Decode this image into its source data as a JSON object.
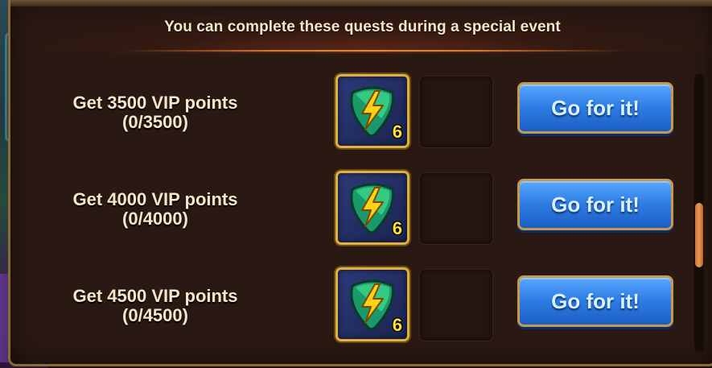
{
  "header": {
    "title": "You can complete these quests during a special event"
  },
  "quests": [
    {
      "title": "Get 3500 VIP points",
      "progress": "(0/3500)",
      "reward": {
        "icon": "energy-guitar-pick-icon",
        "quantity": "6"
      },
      "button_label": "Go for it!"
    },
    {
      "title": "Get 4000 VIP points",
      "progress": "(0/4000)",
      "reward": {
        "icon": "energy-guitar-pick-icon",
        "quantity": "6"
      },
      "button_label": "Go for it!"
    },
    {
      "title": "Get 4500 VIP points",
      "progress": "(0/4500)",
      "reward": {
        "icon": "energy-guitar-pick-icon",
        "quantity": "6"
      },
      "button_label": "Go for it!"
    }
  ],
  "colors": {
    "panel": "#2a1812",
    "frame": "#8a6a3a",
    "text": "#f3e6c9",
    "button": "#2f7fe6",
    "reward_border": "#e0b040",
    "quantity": "#ffe233",
    "scroll_thumb": "#e69a55"
  }
}
